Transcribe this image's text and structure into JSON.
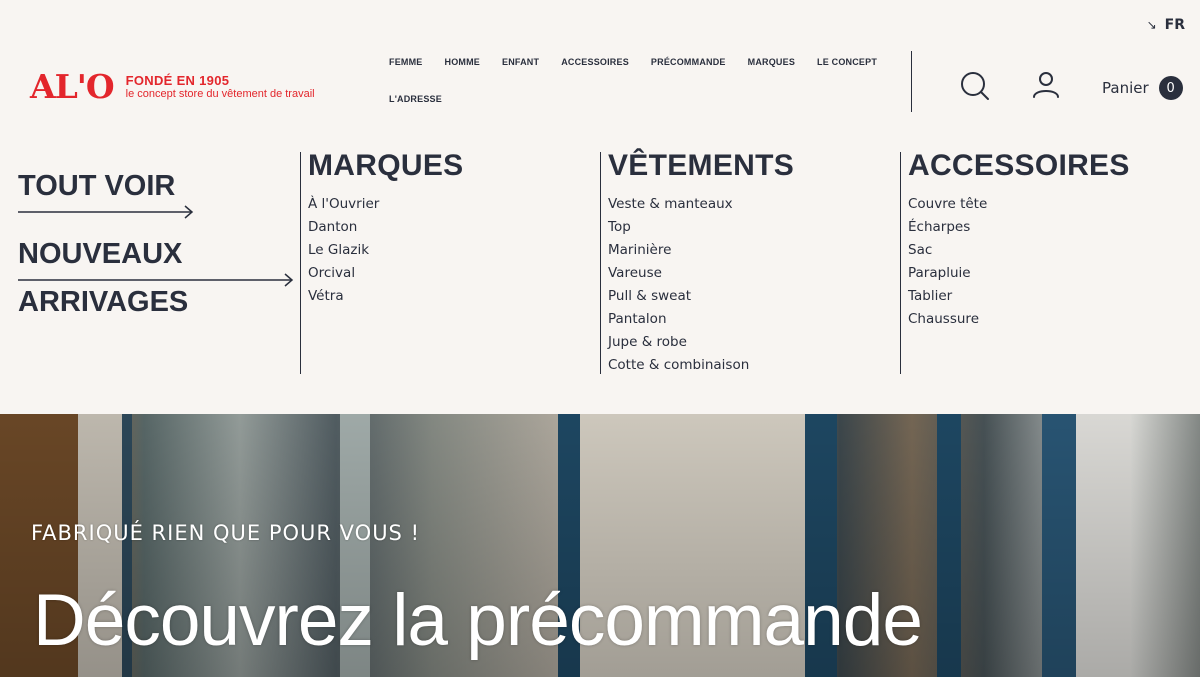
{
  "language": {
    "code": "FR"
  },
  "logo": {
    "mark": "AL'O",
    "tagline_title": "FONDÉ EN 1905",
    "tagline_sub": "le concept store du vêtement de travail"
  },
  "nav": {
    "items": [
      "FEMME",
      "HOMME",
      "ENFANT",
      "ACCESSOIRES",
      "PRÉCOMMANDE",
      "MARQUES",
      "LE CONCEPT",
      "L'ADRESSE"
    ]
  },
  "cart": {
    "label": "Panier",
    "count": "0"
  },
  "menu": {
    "see_all": "TOUT VOIR",
    "new_line1": "NOUVEAUX",
    "new_line2": "ARRIVAGES",
    "columns": [
      {
        "title": "MARQUES",
        "items": [
          "À l'Ouvrier",
          "Danton",
          "Le Glazik",
          "Orcival",
          "Vétra"
        ]
      },
      {
        "title": "VÊTEMENTS",
        "items": [
          "Veste & manteaux",
          "Top",
          "Marinière",
          "Vareuse",
          "Pull & sweat",
          "Pantalon",
          "Jupe & robe",
          "Cotte & combinaison"
        ]
      },
      {
        "title": "ACCESSOIRES",
        "items": [
          "Couvre tête",
          "Écharpes",
          "Sac",
          "Parapluie",
          "Tablier",
          "Chaussure"
        ]
      }
    ]
  },
  "hero": {
    "subtitle": "FABRIQUÉ RIEN QUE POUR VOUS !",
    "title": "Découvrez la précommande"
  },
  "colors": {
    "brand": "#e3262c",
    "ink": "#2a2f3d",
    "background": "#f8f5f2"
  }
}
